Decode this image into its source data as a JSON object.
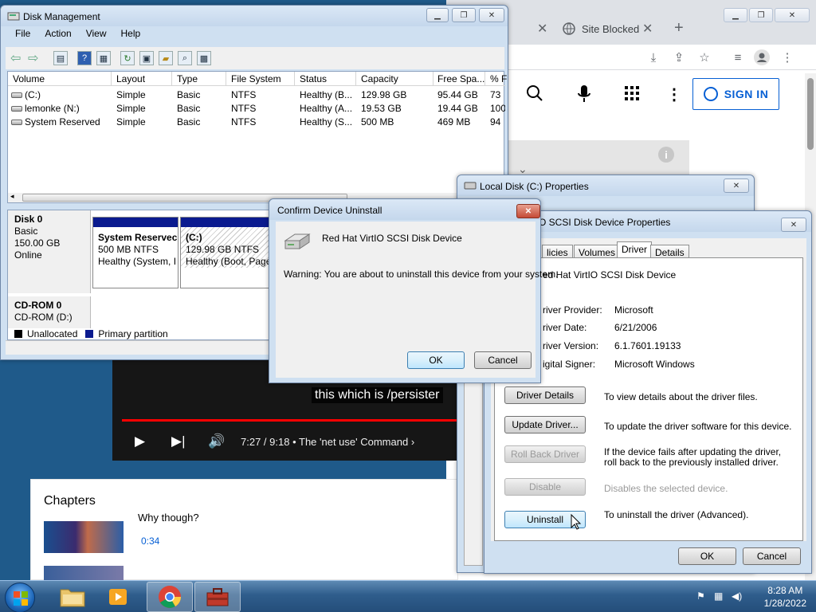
{
  "browser": {
    "tabs": [
      {
        "close": "✕"
      },
      {
        "title": "Site Blocked",
        "close": "✕"
      }
    ],
    "new_tab": "+",
    "window_buttons": {
      "minimize": "▁",
      "maximize": "❐",
      "close": "✕"
    },
    "toolbar_icons": [
      "download-icon",
      "share-icon",
      "star-icon",
      "reading-list-icon",
      "profile-icon",
      "menu-icon"
    ],
    "youtube": {
      "sign_in": "SIGN IN",
      "video_caption": "this which is /persister",
      "time": "7:27 / 9:18",
      "chapter_current": "The 'net use' Command",
      "chapters_title": "Chapters",
      "chapter_item": "Why though?",
      "chapter_time": "0:34"
    }
  },
  "disk_management": {
    "title": "Disk Management",
    "menu": [
      "File",
      "Action",
      "View",
      "Help"
    ],
    "columns": [
      "Volume",
      "Layout",
      "Type",
      "File System",
      "Status",
      "Capacity",
      "Free Spa...",
      "% F"
    ],
    "rows": [
      [
        "(C:)",
        "Simple",
        "Basic",
        "NTFS",
        "Healthy (B...",
        "129.98 GB",
        "95.44 GB",
        "73"
      ],
      [
        "lemonke (N:)",
        "Simple",
        "Basic",
        "NTFS",
        "Healthy (A...",
        "19.53 GB",
        "19.44 GB",
        "100"
      ],
      [
        "System Reserved",
        "Simple",
        "Basic",
        "NTFS",
        "Healthy (S...",
        "500 MB",
        "469 MB",
        "94"
      ]
    ],
    "disk0": {
      "name": "Disk 0",
      "type": "Basic",
      "size": "150.00 GB",
      "state": "Online"
    },
    "partitions": [
      {
        "name": "System Reservec",
        "size": "500 MB NTFS",
        "status": "Healthy (System, I"
      },
      {
        "name": "(C:)",
        "size": "129.98 GB NTFS",
        "status": "Healthy (Boot, Page"
      }
    ],
    "cdrom": {
      "name": "CD-ROM 0",
      "drive": "CD-ROM (D:)"
    },
    "legend": [
      "Unallocated",
      "Primary partition"
    ],
    "colors": {
      "unallocated": "#000000",
      "primary": "#0a1a8f"
    }
  },
  "local_disk_props": {
    "title": "Local Disk (C:) Properties"
  },
  "scsi_props": {
    "title": "O SCSI Disk Device Properties",
    "tabs": [
      "licies",
      "Volumes",
      "Driver",
      "Details"
    ],
    "device": "ed Hat VirtIO SCSI Disk Device",
    "fields": [
      {
        "label": "river Provider:",
        "value": "Microsoft"
      },
      {
        "label": "river Date:",
        "value": "6/21/2006"
      },
      {
        "label": "river Version:",
        "value": "6.1.7601.19133"
      },
      {
        "label": "igital Signer:",
        "value": "Microsoft Windows"
      }
    ],
    "buttons": [
      {
        "label": "Driver Details",
        "desc": "To view details about the driver files."
      },
      {
        "label": "Update Driver...",
        "desc": "To update the driver software for this device."
      },
      {
        "label": "Roll Back Driver",
        "desc": "If the device fails after updating the driver, roll back to the previously installed driver."
      },
      {
        "label": "Disable",
        "desc": "Disables the selected device."
      },
      {
        "label": "Uninstall",
        "desc": "To uninstall the driver (Advanced)."
      }
    ],
    "ok": "OK",
    "cancel": "Cancel"
  },
  "confirm": {
    "title": "Confirm Device Uninstall",
    "device": "Red Hat VirtIO SCSI Disk Device",
    "warning": "Warning: You are about to uninstall this device from your system.",
    "ok": "OK",
    "cancel": "Cancel"
  },
  "taskbar": {
    "time": "8:28 AM",
    "date": "1/28/2022"
  }
}
